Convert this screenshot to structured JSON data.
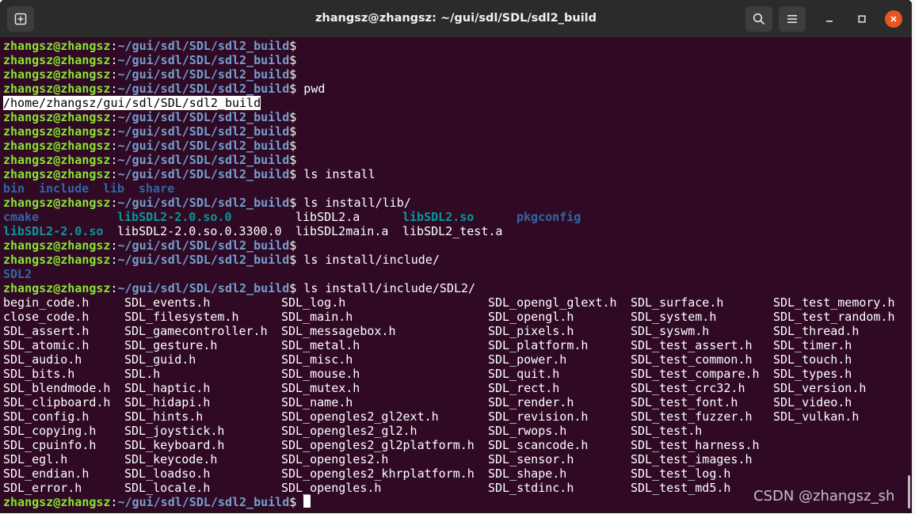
{
  "window": {
    "title": "zhangsz@zhangsz: ~/gui/sdl/SDL/sdl2_build"
  },
  "titlebar": {
    "new_tab_icon": "new-tab-icon",
    "search_icon": "search-icon",
    "menu_icon": "hamburger-menu-icon",
    "minimize_icon": "minimize-icon",
    "maximize_icon": "maximize-icon",
    "close_icon": "close-icon"
  },
  "prompt": {
    "user": "zhangsz@zhangsz",
    "sep": ":",
    "path": "~/gui/sdl/SDL/sdl2_build",
    "symbol": "$"
  },
  "terminal": {
    "lines": [
      {
        "type": "prompt",
        "cmd": ""
      },
      {
        "type": "prompt",
        "cmd": ""
      },
      {
        "type": "prompt",
        "cmd": ""
      },
      {
        "type": "prompt",
        "cmd": " pwd"
      },
      {
        "type": "highlight",
        "text": "/home/zhangsz/gui/sdl/SDL/sdl2_build"
      },
      {
        "type": "prompt",
        "cmd": ""
      },
      {
        "type": "prompt",
        "cmd": ""
      },
      {
        "type": "prompt",
        "cmd": ""
      },
      {
        "type": "prompt",
        "cmd": ""
      },
      {
        "type": "prompt",
        "cmd": " ls install"
      },
      {
        "type": "cols",
        "cells": [
          {
            "t": "bin",
            "c": "dir"
          },
          {
            "t": "include",
            "c": "dir"
          },
          {
            "t": "lib",
            "c": "dir"
          },
          {
            "t": "share",
            "c": "dir"
          }
        ]
      },
      {
        "type": "prompt",
        "cmd": " ls install/lib/"
      },
      {
        "type": "cols",
        "cells": [
          {
            "t": "cmake",
            "c": "dir"
          },
          {
            "t": "libSDL2-2.0.so.0",
            "c": "lnk"
          },
          {
            "t": "libSDL2.a",
            "c": ""
          },
          {
            "t": "libSDL2.so",
            "c": "lnk"
          },
          {
            "t": "pkgconfig",
            "c": "dir"
          }
        ]
      },
      {
        "type": "cols",
        "cells": [
          {
            "t": "libSDL2-2.0.so",
            "c": "lnk"
          },
          {
            "t": "libSDL2-2.0.so.0.3300.0",
            "c": ""
          },
          {
            "t": "libSDL2main.a",
            "c": ""
          },
          {
            "t": "libSDL2_test.a",
            "c": ""
          }
        ]
      },
      {
        "type": "prompt",
        "cmd": ""
      },
      {
        "type": "prompt",
        "cmd": " ls install/include/"
      },
      {
        "type": "cols",
        "cells": [
          {
            "t": "SDL2",
            "c": "dir"
          }
        ]
      },
      {
        "type": "prompt",
        "cmd": " ls install/include/SDL2/"
      },
      {
        "type": "cols",
        "cells": [
          {
            "t": "begin_code.h"
          },
          {
            "t": "SDL_events.h"
          },
          {
            "t": "SDL_log.h"
          },
          {
            "t": "SDL_opengl_glext.h"
          },
          {
            "t": "SDL_surface.h"
          },
          {
            "t": "SDL_test_memory.h"
          }
        ]
      },
      {
        "type": "cols",
        "cells": [
          {
            "t": "close_code.h"
          },
          {
            "t": "SDL_filesystem.h"
          },
          {
            "t": "SDL_main.h"
          },
          {
            "t": "SDL_opengl.h"
          },
          {
            "t": "SDL_system.h"
          },
          {
            "t": "SDL_test_random.h"
          }
        ]
      },
      {
        "type": "cols",
        "cells": [
          {
            "t": "SDL_assert.h"
          },
          {
            "t": "SDL_gamecontroller.h"
          },
          {
            "t": "SDL_messagebox.h"
          },
          {
            "t": "SDL_pixels.h"
          },
          {
            "t": "SDL_syswm.h"
          },
          {
            "t": "SDL_thread.h"
          }
        ]
      },
      {
        "type": "cols",
        "cells": [
          {
            "t": "SDL_atomic.h"
          },
          {
            "t": "SDL_gesture.h"
          },
          {
            "t": "SDL_metal.h"
          },
          {
            "t": "SDL_platform.h"
          },
          {
            "t": "SDL_test_assert.h"
          },
          {
            "t": "SDL_timer.h"
          }
        ]
      },
      {
        "type": "cols",
        "cells": [
          {
            "t": "SDL_audio.h"
          },
          {
            "t": "SDL_guid.h"
          },
          {
            "t": "SDL_misc.h"
          },
          {
            "t": "SDL_power.h"
          },
          {
            "t": "SDL_test_common.h"
          },
          {
            "t": "SDL_touch.h"
          }
        ]
      },
      {
        "type": "cols",
        "cells": [
          {
            "t": "SDL_bits.h"
          },
          {
            "t": "SDL.h"
          },
          {
            "t": "SDL_mouse.h"
          },
          {
            "t": "SDL_quit.h"
          },
          {
            "t": "SDL_test_compare.h"
          },
          {
            "t": "SDL_types.h"
          }
        ]
      },
      {
        "type": "cols",
        "cells": [
          {
            "t": "SDL_blendmode.h"
          },
          {
            "t": "SDL_haptic.h"
          },
          {
            "t": "SDL_mutex.h"
          },
          {
            "t": "SDL_rect.h"
          },
          {
            "t": "SDL_test_crc32.h"
          },
          {
            "t": "SDL_version.h"
          }
        ]
      },
      {
        "type": "cols",
        "cells": [
          {
            "t": "SDL_clipboard.h"
          },
          {
            "t": "SDL_hidapi.h"
          },
          {
            "t": "SDL_name.h"
          },
          {
            "t": "SDL_render.h"
          },
          {
            "t": "SDL_test_font.h"
          },
          {
            "t": "SDL_video.h"
          }
        ]
      },
      {
        "type": "cols",
        "cells": [
          {
            "t": "SDL_config.h"
          },
          {
            "t": "SDL_hints.h"
          },
          {
            "t": "SDL_opengles2_gl2ext.h"
          },
          {
            "t": "SDL_revision.h"
          },
          {
            "t": "SDL_test_fuzzer.h"
          },
          {
            "t": "SDL_vulkan.h"
          }
        ]
      },
      {
        "type": "cols",
        "cells": [
          {
            "t": "SDL_copying.h"
          },
          {
            "t": "SDL_joystick.h"
          },
          {
            "t": "SDL_opengles2_gl2.h"
          },
          {
            "t": "SDL_rwops.h"
          },
          {
            "t": "SDL_test.h"
          }
        ]
      },
      {
        "type": "cols",
        "cells": [
          {
            "t": "SDL_cpuinfo.h"
          },
          {
            "t": "SDL_keyboard.h"
          },
          {
            "t": "SDL_opengles2_gl2platform.h"
          },
          {
            "t": "SDL_scancode.h"
          },
          {
            "t": "SDL_test_harness.h"
          }
        ]
      },
      {
        "type": "cols",
        "cells": [
          {
            "t": "SDL_egl.h"
          },
          {
            "t": "SDL_keycode.h"
          },
          {
            "t": "SDL_opengles2.h"
          },
          {
            "t": "SDL_sensor.h"
          },
          {
            "t": "SDL_test_images.h"
          }
        ]
      },
      {
        "type": "cols",
        "cells": [
          {
            "t": "SDL_endian.h"
          },
          {
            "t": "SDL_loadso.h"
          },
          {
            "t": "SDL_opengles2_khrplatform.h"
          },
          {
            "t": "SDL_shape.h"
          },
          {
            "t": "SDL_test_log.h"
          }
        ]
      },
      {
        "type": "cols",
        "cells": [
          {
            "t": "SDL_error.h"
          },
          {
            "t": "SDL_locale.h"
          },
          {
            "t": "SDL_opengles.h"
          },
          {
            "t": "SDL_stdinc.h"
          },
          {
            "t": "SDL_test_md5.h"
          }
        ]
      },
      {
        "type": "prompt",
        "cmd": " ",
        "cursor": true
      }
    ]
  },
  "watermark": "CSDN @zhangsz_sh",
  "colors": {
    "background": "#300a24",
    "user": "#8ae234",
    "path": "#729fcf",
    "directory": "#3465a4",
    "symlink": "#06989a",
    "close_button": "#e95420"
  }
}
